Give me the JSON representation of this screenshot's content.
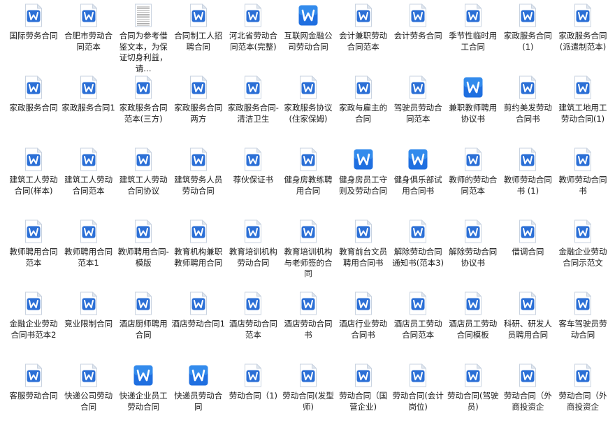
{
  "colors": {
    "doc_page": "#ffffff",
    "doc_border": "#c9d3e0",
    "doc_fold": "#dfe6ef",
    "word_badge": "#2b6fd6",
    "word_badge_gradient_top": "#43a2f5",
    "word_badge_gradient_bottom": "#1f6fe0",
    "text_page_lines": "#9a9a9a"
  },
  "files": [
    {
      "name": "国际劳务合同",
      "icon": "word-doc-icon"
    },
    {
      "name": "合肥市劳动合同范本",
      "icon": "word-doc-icon"
    },
    {
      "name": "合同为参考借鉴文本，为保证切身利益，请…",
      "icon": "text-doc-icon"
    },
    {
      "name": "合同制工人招聘合同",
      "icon": "word-doc-icon"
    },
    {
      "name": "河北省劳动合同范本(完整)",
      "icon": "word-doc-icon"
    },
    {
      "name": "互联网金融公司劳动合同",
      "icon": "word-app-icon"
    },
    {
      "name": "会计兼职劳动合同范本",
      "icon": "word-doc-icon"
    },
    {
      "name": "会计劳务合同",
      "icon": "word-doc-icon"
    },
    {
      "name": "季节性临时用工合同",
      "icon": "word-doc-icon"
    },
    {
      "name": "家政服务合同(1)",
      "icon": "word-doc-icon"
    },
    {
      "name": "家政服务合同(派遣制范本)",
      "icon": "word-doc-icon"
    },
    {
      "name": "家政服务合同",
      "icon": "word-doc-icon"
    },
    {
      "name": "家政服务合同1",
      "icon": "word-doc-icon"
    },
    {
      "name": "家政服务合同范本(三方)",
      "icon": "word-doc-icon"
    },
    {
      "name": "家政服务合同两方",
      "icon": "word-doc-icon"
    },
    {
      "name": "家政服务合同-清洁卫生",
      "icon": "word-doc-icon"
    },
    {
      "name": "家政服务协议(住家保姆)",
      "icon": "word-doc-icon"
    },
    {
      "name": "家政与雇主的合同",
      "icon": "word-doc-icon"
    },
    {
      "name": "驾驶员劳动合同范本",
      "icon": "word-doc-icon"
    },
    {
      "name": "兼职教师聘用协议书",
      "icon": "word-app-icon"
    },
    {
      "name": "剪约美发劳动合同书",
      "icon": "word-doc-icon"
    },
    {
      "name": "建筑工地用工劳动合同(1)",
      "icon": "word-doc-icon"
    },
    {
      "name": "建筑工人劳动合同(样本)",
      "icon": "word-doc-icon"
    },
    {
      "name": "建筑工人劳动合同范本",
      "icon": "word-doc-icon"
    },
    {
      "name": "建筑工人劳动合同协议",
      "icon": "word-doc-icon"
    },
    {
      "name": "建筑劳务人员劳动合同",
      "icon": "word-doc-icon"
    },
    {
      "name": "荐伙保证书",
      "icon": "word-doc-icon"
    },
    {
      "name": "健身房教练聘用合同",
      "icon": "word-doc-icon"
    },
    {
      "name": "健身房员工守则及劳动合同",
      "icon": "word-app-icon"
    },
    {
      "name": "健身俱乐部试用合同书",
      "icon": "word-app-icon"
    },
    {
      "name": "教师的劳动合同范本",
      "icon": "word-doc-icon"
    },
    {
      "name": "教师劳动合同书 (1)",
      "icon": "word-doc-icon"
    },
    {
      "name": "教师劳动合同书",
      "icon": "word-doc-icon"
    },
    {
      "name": "教师聘用合同范本",
      "icon": "word-doc-icon"
    },
    {
      "name": "教师聘用合同范本1",
      "icon": "word-doc-icon"
    },
    {
      "name": "教师聘用合同-模版",
      "icon": "word-doc-icon"
    },
    {
      "name": "教育机构兼职教师聘用合同",
      "icon": "word-doc-icon"
    },
    {
      "name": "教育培训机构劳动合同",
      "icon": "word-doc-icon"
    },
    {
      "name": "教育培训机构与老师签的合同",
      "icon": "word-doc-icon"
    },
    {
      "name": "教育前台文员聘用合同书",
      "icon": "word-doc-icon"
    },
    {
      "name": "解除劳动合同通知书(范本3)",
      "icon": "word-doc-icon"
    },
    {
      "name": "解除劳动合同协议书",
      "icon": "word-doc-icon"
    },
    {
      "name": "借调合同",
      "icon": "word-doc-icon"
    },
    {
      "name": "金融企业劳动合同示范文",
      "icon": "word-doc-icon"
    },
    {
      "name": "金融企业劳动合同书范本2",
      "icon": "word-doc-icon"
    },
    {
      "name": "竞业限制合同",
      "icon": "word-doc-icon"
    },
    {
      "name": "酒店厨师聘用合同",
      "icon": "word-doc-icon"
    },
    {
      "name": "酒店劳动合同1",
      "icon": "word-doc-icon"
    },
    {
      "name": "酒店劳动合同范本",
      "icon": "word-doc-icon"
    },
    {
      "name": "酒店劳动合同书",
      "icon": "word-doc-icon"
    },
    {
      "name": "酒店行业劳动合同书",
      "icon": "word-doc-icon"
    },
    {
      "name": "酒店员工劳动合同范本",
      "icon": "word-doc-icon"
    },
    {
      "name": "酒店员工劳动合同模板",
      "icon": "word-doc-icon"
    },
    {
      "name": "科研、研发人员聘用合同",
      "icon": "word-doc-icon"
    },
    {
      "name": "客车驾驶员劳动合同",
      "icon": "word-doc-icon"
    },
    {
      "name": "客服劳动合同",
      "icon": "word-doc-icon"
    },
    {
      "name": "快递公司劳动合同",
      "icon": "word-doc-icon"
    },
    {
      "name": "快递企业员工劳动合同",
      "icon": "word-app-icon"
    },
    {
      "name": "快递员劳动合同",
      "icon": "word-app-icon"
    },
    {
      "name": "劳动合同（1)",
      "icon": "word-doc-icon"
    },
    {
      "name": "劳动合同(发型师)",
      "icon": "word-doc-icon"
    },
    {
      "name": "劳动合同（国营企业)",
      "icon": "word-doc-icon"
    },
    {
      "name": "劳动合同(会计岗位)",
      "icon": "word-doc-icon"
    },
    {
      "name": "劳动合同(驾驶员)",
      "icon": "word-doc-icon"
    },
    {
      "name": "劳动合同（外商投资企",
      "icon": "word-doc-icon"
    },
    {
      "name": "劳动合同（外商投资企",
      "icon": "word-doc-icon"
    }
  ]
}
